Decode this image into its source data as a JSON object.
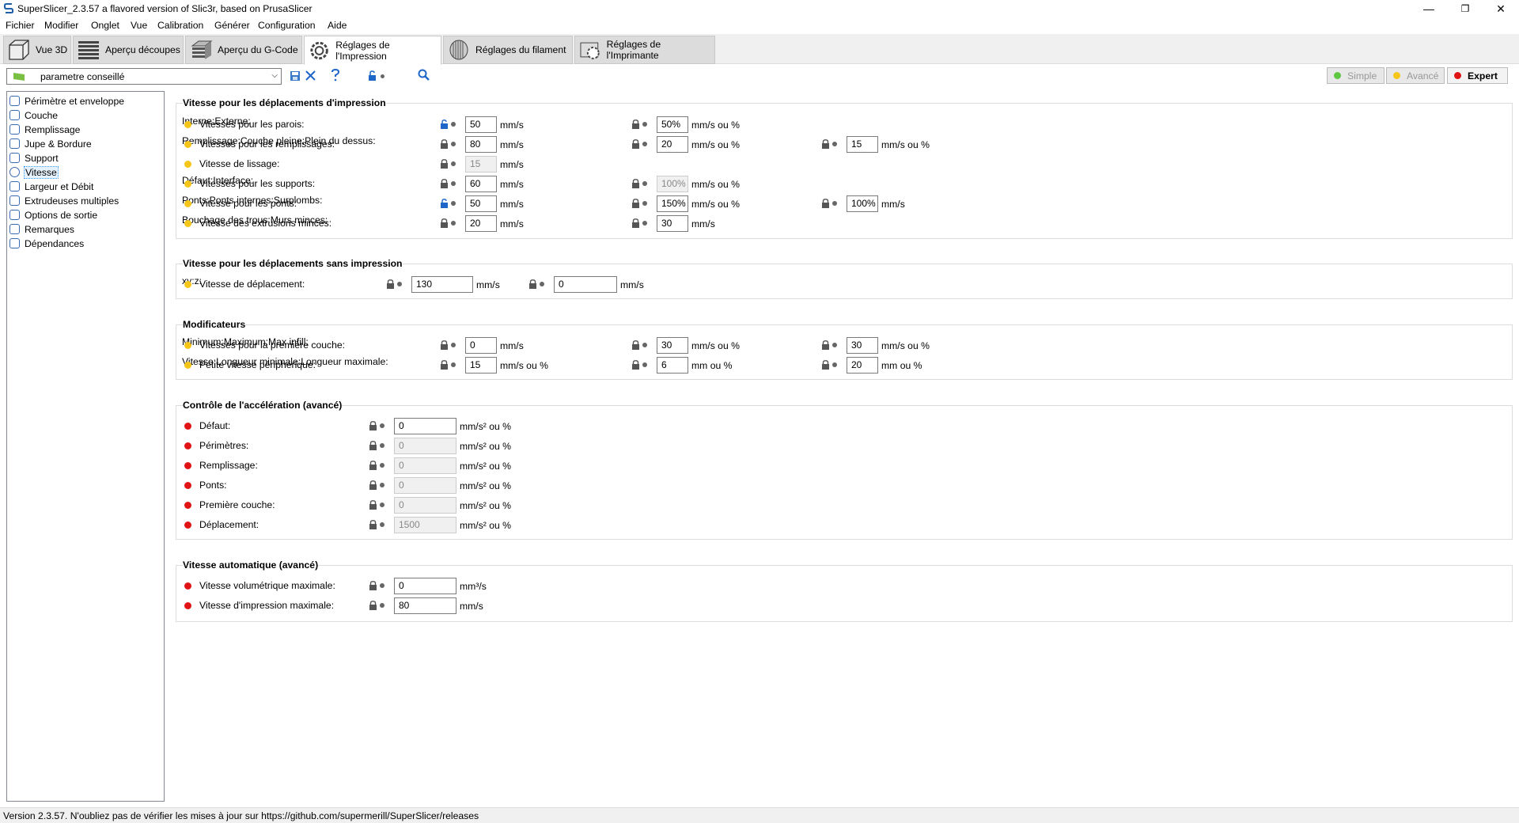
{
  "window": {
    "title": "SuperSlicer_2.3.57 a flavored version of Slic3r, based on PrusaSlicer",
    "minimize": "—",
    "restore": "❐",
    "close": "✕"
  },
  "menu": [
    "Fichier",
    "Modifier",
    "Onglet",
    "Vue",
    "Calibration",
    "Générer",
    "Configuration",
    "Aide"
  ],
  "tabs": [
    {
      "label": "Vue 3D"
    },
    {
      "label": "Aperçu découpes"
    },
    {
      "label": "Aperçu du G-Code"
    },
    {
      "label": "Réglages de l'Impression"
    },
    {
      "label": "Réglages du filament"
    },
    {
      "label": "Réglages de l'Imprimante"
    }
  ],
  "preset": {
    "value": "parametre conseillé"
  },
  "modes": {
    "simple": "Simple",
    "advanced": "Avancé",
    "expert": "Expert",
    "colors": {
      "simple": "#5dc742",
      "advanced": "#f5c518",
      "expert": "#e01414"
    }
  },
  "sidebar": [
    "Périmètre et enveloppe",
    "Couche",
    "Remplissage",
    "Jupe & Bordure",
    "Support",
    "Vitesse",
    "Largeur et Débit",
    "Extrudeuses multiples",
    "Options de sortie",
    "Remarques",
    "Dépendances"
  ],
  "groups": {
    "print": {
      "title": "Vitesse pour les déplacements d'impression",
      "rows": [
        {
          "label": "Vitesses pour les parois:",
          "f": [
            {
              "l": "Interne:",
              "v": "50",
              "u": "mm/s"
            },
            {
              "l": "Externe:",
              "v": "50%",
              "u": "mm/s ou %"
            }
          ]
        },
        {
          "label": "Vitesses pour les remplissages:",
          "f": [
            {
              "l": "Remplissage:",
              "v": "80",
              "u": "mm/s"
            },
            {
              "l": "Couche pleine:",
              "v": "20",
              "u": "mm/s ou %"
            },
            {
              "l": "Plein du dessus:",
              "v": "15",
              "u": "mm/s ou %"
            }
          ]
        },
        {
          "label": "Vitesse de lissage:",
          "f": [
            {
              "l": "",
              "v": "15",
              "u": "mm/s"
            }
          ]
        },
        {
          "label": "Vitesses pour les supports:",
          "f": [
            {
              "l": "Défaut:",
              "v": "60",
              "u": "mm/s"
            },
            {
              "l": "Interface:",
              "v": "100%",
              "u": "mm/s ou %"
            }
          ]
        },
        {
          "label": "Vitesse pour les ponts:",
          "f": [
            {
              "l": "Ponts:",
              "v": "50",
              "u": "mm/s"
            },
            {
              "l": "Ponts internes:",
              "v": "150%",
              "u": "mm/s ou %"
            },
            {
              "l": "Surplombs:",
              "v": "100%",
              "u": "mm/s"
            }
          ]
        },
        {
          "label": "Vitesse des extrusions minces:",
          "f": [
            {
              "l": "Bouchage des trous:",
              "v": "20",
              "u": "mm/s"
            },
            {
              "l": "Murs minces:",
              "v": "30",
              "u": "mm/s"
            }
          ]
        }
      ]
    },
    "travel": {
      "title": "Vitesse pour les déplacements sans impression",
      "rows": [
        {
          "label": "Vitesse de déplacement:",
          "f": [
            {
              "l": "xy:",
              "v": "130",
              "u": "mm/s"
            },
            {
              "l": "z:",
              "v": "0",
              "u": "mm/s"
            }
          ]
        }
      ]
    },
    "modifiers": {
      "title": "Modificateurs",
      "rows": [
        {
          "label": "Vitesses pour la première couche:",
          "f": [
            {
              "l": "Minimum:",
              "v": "0",
              "u": "mm/s"
            },
            {
              "l": "Maximum:",
              "v": "30",
              "u": "mm/s ou %"
            },
            {
              "l": "Max infill:",
              "v": "30",
              "u": "mm/s ou %"
            }
          ]
        },
        {
          "label": "Petite vitesse périphérique:",
          "f": [
            {
              "l": "Vitesse:",
              "v": "15",
              "u": "mm/s ou %"
            },
            {
              "l": "Longueur minimale:",
              "v": "6",
              "u": "mm ou %"
            },
            {
              "l": "Longueur maximale:",
              "v": "20",
              "u": "mm ou %"
            }
          ]
        }
      ]
    },
    "accel": {
      "title": "Contrôle de l'accélération (avancé)",
      "rows": [
        {
          "label": "Défaut:",
          "v": "0",
          "u": "mm/s² ou %"
        },
        {
          "label": "Périmètres:",
          "v": "0",
          "u": "mm/s² ou %"
        },
        {
          "label": "Remplissage:",
          "v": "0",
          "u": "mm/s² ou %"
        },
        {
          "label": "Ponts:",
          "v": "0",
          "u": "mm/s² ou %"
        },
        {
          "label": "Première couche:",
          "v": "0",
          "u": "mm/s² ou %"
        },
        {
          "label": "Déplacement:",
          "v": "1500",
          "u": "mm/s² ou %"
        }
      ]
    },
    "auto": {
      "title": "Vitesse automatique (avancé)",
      "rows": [
        {
          "label": "Vitesse volumétrique maximale:",
          "v": "0",
          "u": "mm³/s"
        },
        {
          "label": "Vitesse d'impression maximale:",
          "v": "80",
          "u": "mm/s"
        }
      ]
    }
  },
  "status": "Version 2.3.57. N'oubliez pas de vérifier les mises à jour sur https://github.com/supermerill/SuperSlicer/releases"
}
